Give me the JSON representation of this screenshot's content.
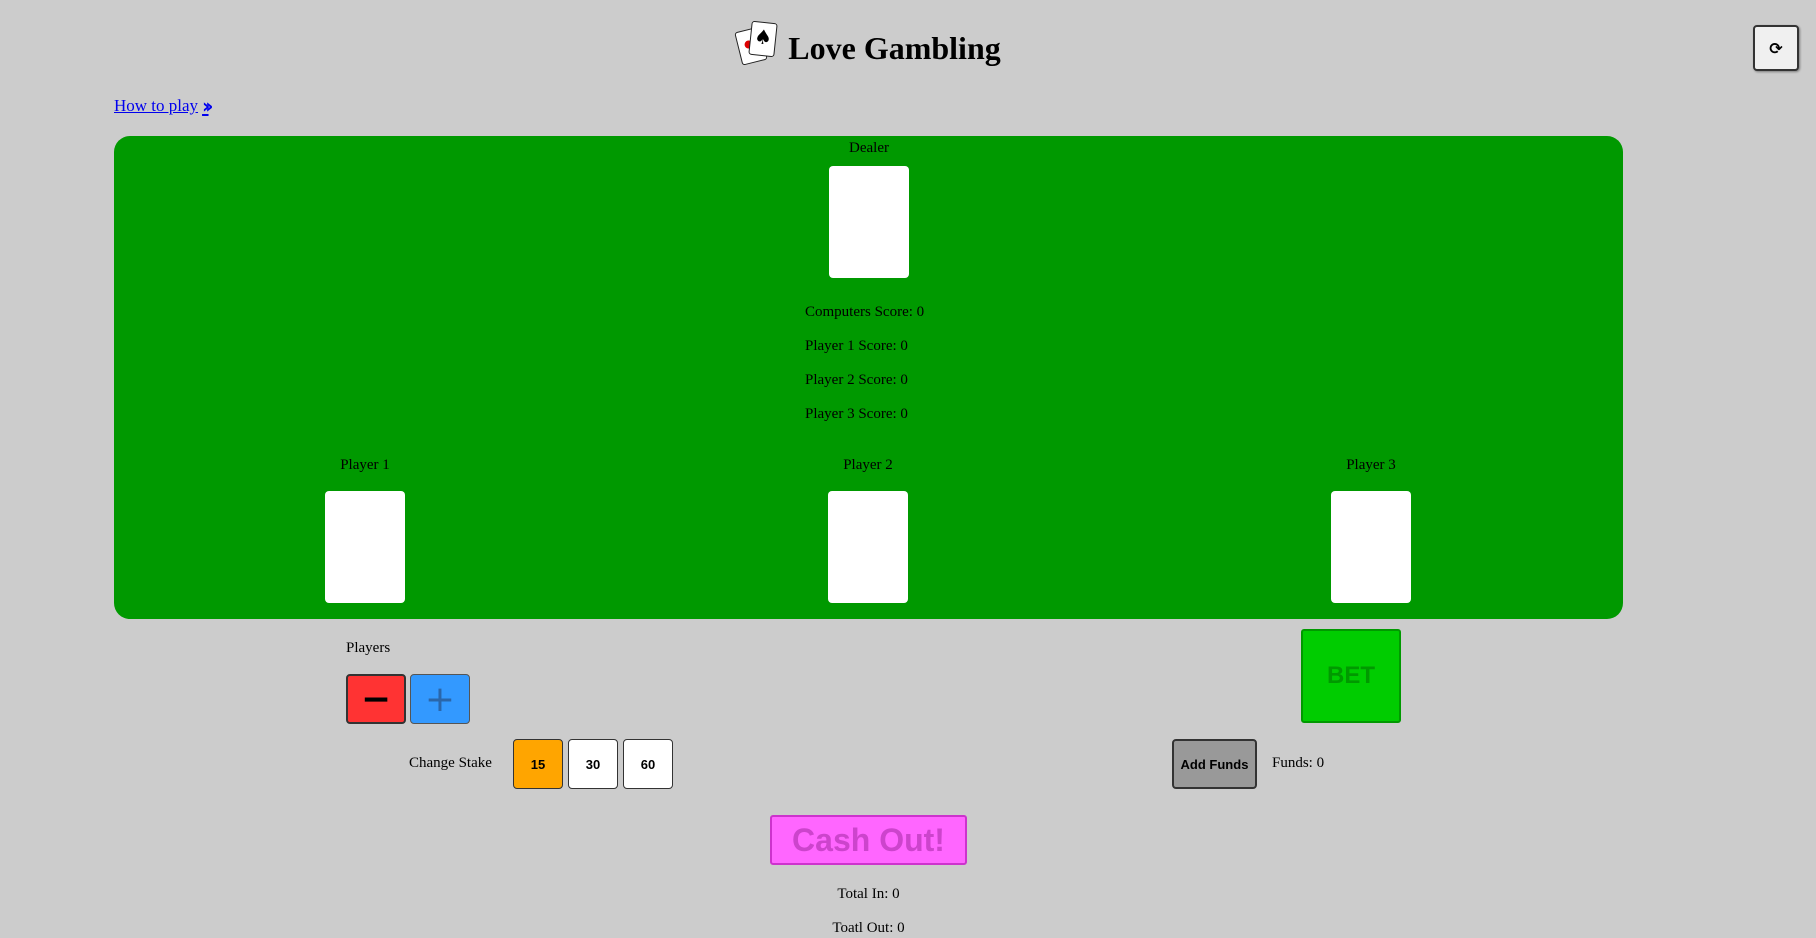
{
  "header": {
    "title": "Love Gambling",
    "logo_icon": "playing-cards-icon",
    "refresh_icon": "refresh-icon"
  },
  "howto": {
    "label": "How to play",
    "icon": "double-chevron-right-icon"
  },
  "table": {
    "color": "#009900",
    "dealer_label": "Dealer",
    "scores": [
      "Computers Score: 0",
      "Player 1 Score: 0",
      "Player 2 Score: 0",
      "Player 3 Score: 0"
    ],
    "players": [
      "Player 1",
      "Player 2",
      "Player 3"
    ]
  },
  "controls": {
    "players_label": "Players",
    "minus_icon": "minus-icon",
    "plus_icon": "plus-icon",
    "stake_label": "Change Stake",
    "stakes": [
      "15",
      "30",
      "60"
    ],
    "selected_stake": "15",
    "bet_label": "BET",
    "add_funds_label": "Add Funds",
    "funds_text": "Funds: 0",
    "cashout_label": "Cash Out!",
    "total_in": "Total In: 0",
    "total_out": "Toatl Out: 0"
  },
  "colors": {
    "background": "#cccccc",
    "minus": "#ff3333",
    "plus": "#3399ff",
    "stake_active": "#ffa500",
    "bet": "#00cc00",
    "add_funds": "#999999",
    "cashout": "#ff66ff"
  }
}
